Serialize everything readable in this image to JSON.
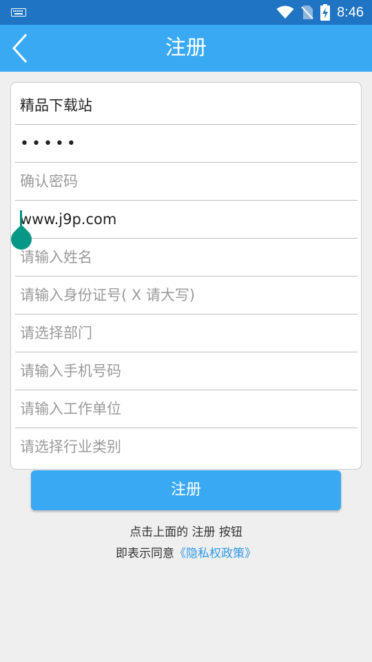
{
  "status_bar": {
    "time": "8:46",
    "icons": [
      "keyboard-icon",
      "wifi-icon",
      "no-sim-icon",
      "battery-charging-icon"
    ]
  },
  "header": {
    "back_icon": "chevron-left-icon",
    "title": "注册"
  },
  "form": {
    "username_value": "精品下载站",
    "password_value": "•••••",
    "confirm_password_placeholder": "确认密码",
    "email_value": "www.j9p.com",
    "name_placeholder": "请输入姓名",
    "id_number_placeholder": "请输入身份证号( X 请大写)",
    "department_placeholder": "请选择部门",
    "phone_placeholder": "请输入手机号码",
    "employer_placeholder": "请输入工作单位",
    "industry_placeholder": "请选择行业类别"
  },
  "register_button_label": "注册",
  "agreement": {
    "line1": "点击上面的 注册 按钮",
    "line2_prefix": "即表示同意",
    "privacy_link": "《隐私权政策》"
  },
  "colors": {
    "status_bar": "#1f74c4",
    "accent": "#3aa9f4",
    "link": "#2f9ae8",
    "cursor": "#069886"
  }
}
